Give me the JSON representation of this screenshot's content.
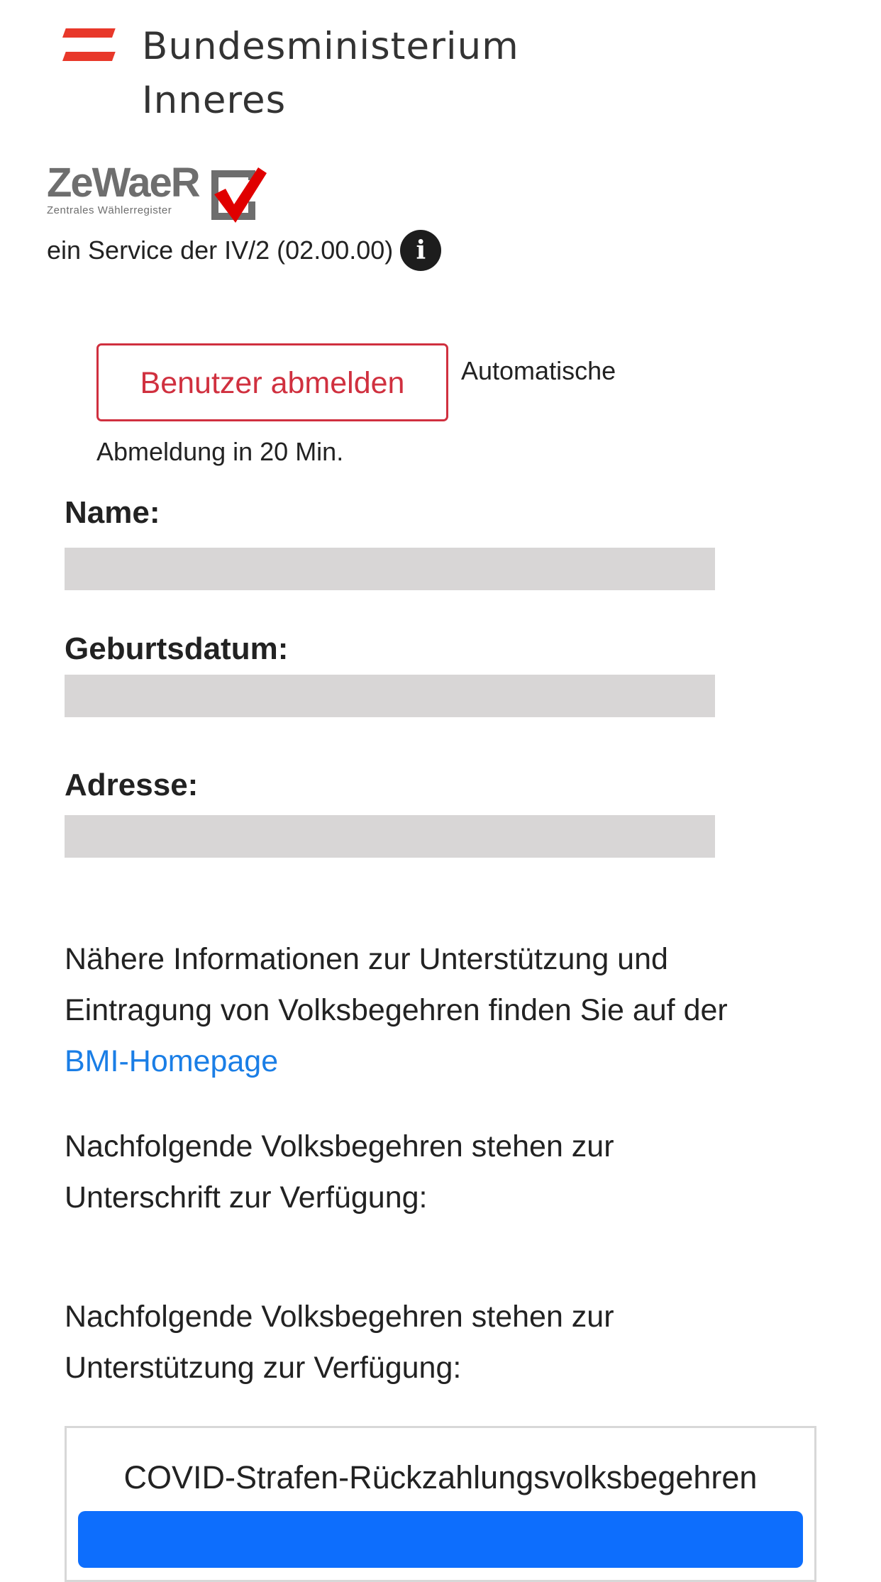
{
  "header": {
    "ministry_title_line1": "Bundesministerium",
    "ministry_title_line2": "Inneres",
    "flag_color": "#e8382a"
  },
  "logo": {
    "name": "ZeWaeR",
    "subtitle": "Zentrales Wählerregister",
    "accent_color": "#e00000"
  },
  "service": {
    "text": "ein Service der IV/2 (02.00.00)",
    "info_icon": "i"
  },
  "session": {
    "logout_label": "Benutzer abmelden",
    "auto_logout_part1": "Automatische",
    "auto_logout_part2": "Abmeldung in 20 Min.",
    "logout_color": "#d0303f"
  },
  "profile": {
    "name_label": "Name:",
    "birthdate_label": "Geburtsdatum:",
    "address_label": "Adresse:"
  },
  "info": {
    "text_line1": "Nähere Informationen zur Unterstützung und",
    "text_line2": "Eintragung von Volksbegehren finden Sie auf der",
    "link_label": "BMI-Homepage",
    "link_color": "#1a7ee6"
  },
  "sections": {
    "signature_line1": "Nachfolgende Volksbegehren stehen zur",
    "signature_line2": "Unterschrift zur Verfügung:",
    "support_line1": "Nachfolgende Volksbegehren stehen zur",
    "support_line2": "Unterstützung zur Verfügung:"
  },
  "initiatives": [
    {
      "title": "COVID-Strafen-Rückzahlungsvolksbegehren",
      "button_color": "#0d6efd"
    }
  ]
}
